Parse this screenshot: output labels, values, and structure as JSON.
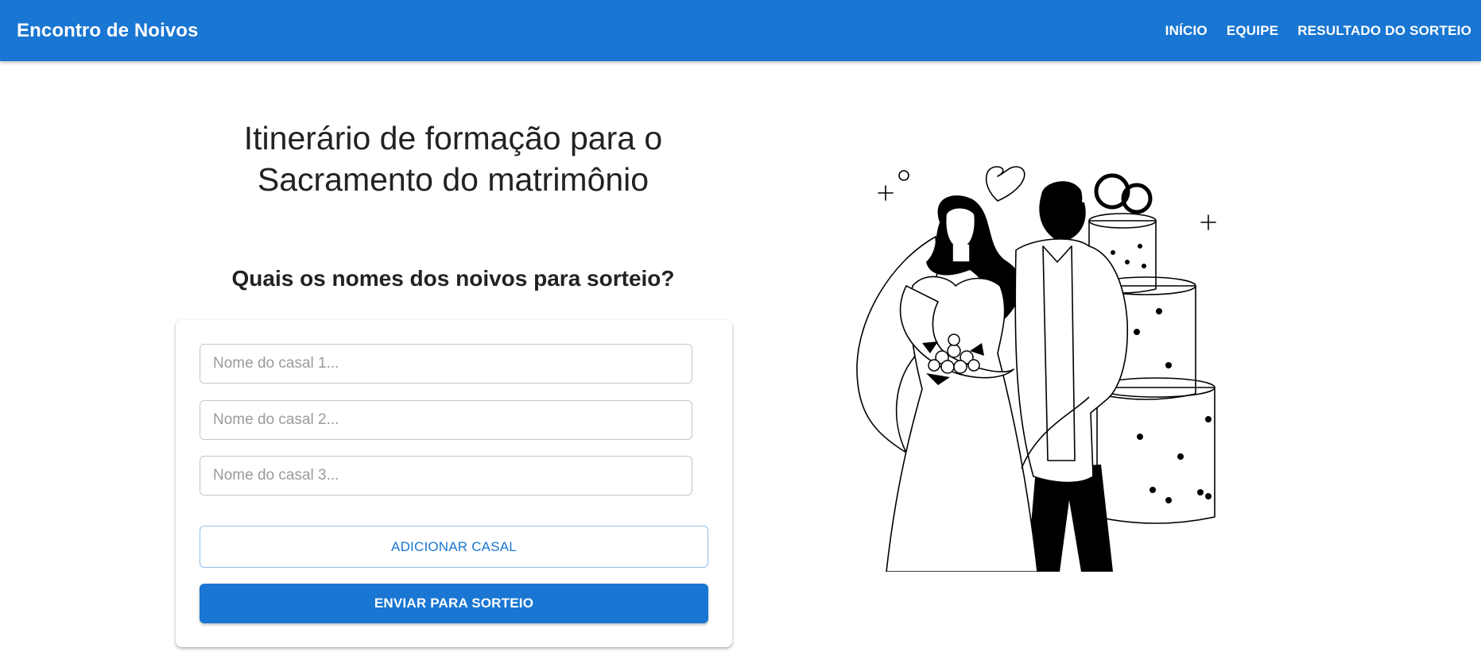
{
  "header": {
    "brand": "Encontro de Noivos",
    "nav": [
      "INÍCIO",
      "EQUIPE",
      "RESULTADO DO SORTEIO"
    ]
  },
  "main": {
    "title_line1": "Itinerário de formação para o",
    "title_line2": "Sacramento do matrimônio",
    "subtitle": "Quais os nomes dos noivos para sorteio?"
  },
  "form": {
    "fields": [
      {
        "placeholder": "Nome do casal 1...",
        "value": ""
      },
      {
        "placeholder": "Nome do casal 2...",
        "value": ""
      },
      {
        "placeholder": "Nome do casal 3...",
        "value": ""
      }
    ],
    "add_label": "ADICIONAR CASAL",
    "submit_label": "ENVIAR PARA SORTEIO"
  },
  "illustration": {
    "icon": "wedding-couple-illustration"
  },
  "colors": {
    "primary": "#1976d2",
    "outline_border": "#90bde9"
  }
}
